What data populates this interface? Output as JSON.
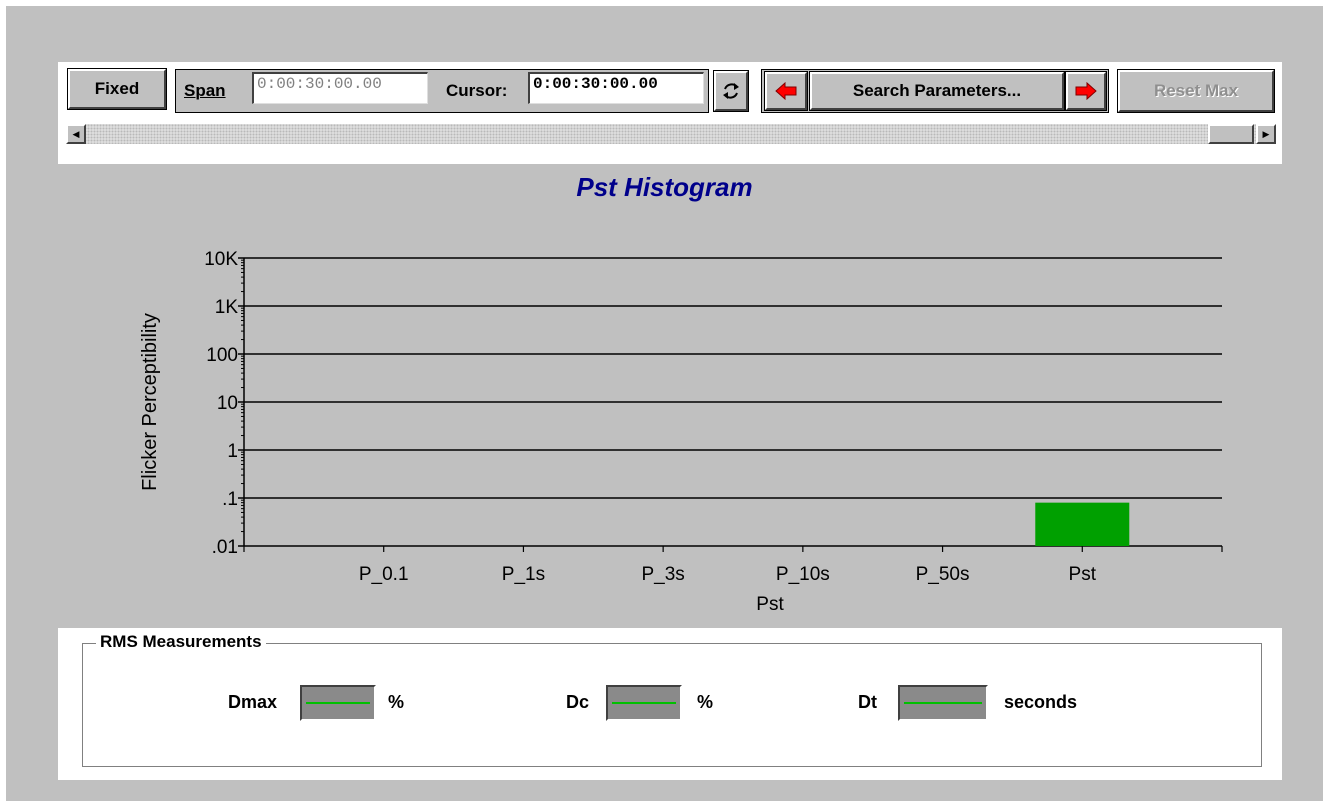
{
  "toolbar": {
    "fixed_label": "Fixed",
    "span_label": "Span",
    "span_value": "0:00:30:00.00",
    "cursor_label": "Cursor:",
    "cursor_value": "0:00:30:00.00",
    "refresh_icon": "refresh-icon",
    "prev_icon": "left-arrow-icon",
    "search_label": "Search Parameters...",
    "next_icon": "right-arrow-icon",
    "reset_label": "Reset Max",
    "reset_enabled": false
  },
  "scrollbar": {
    "left_icon": "scroll-left-icon",
    "right_icon": "scroll-right-icon",
    "thumb_position": "right"
  },
  "chart_data": {
    "type": "bar",
    "title": "Pst Histogram",
    "xlabel": "Pst",
    "ylabel": "Flicker Perceptibility",
    "y_scale": "log",
    "ylim": [
      0.01,
      10000
    ],
    "y_ticks": [
      ".01",
      ".1",
      "1",
      "10",
      "100",
      "1K",
      "10K"
    ],
    "grid": true,
    "categories": [
      "P_0.1",
      "P_1s",
      "P_3s",
      "P_10s",
      "P_50s",
      "Pst"
    ],
    "values": [
      null,
      null,
      null,
      null,
      null,
      0.08
    ],
    "bar_color": "#00a000"
  },
  "rms": {
    "title": "RMS Measurements",
    "dmax_label": "Dmax",
    "dmax_unit": "%",
    "dc_label": "Dc",
    "dc_unit": "%",
    "dt_label": "Dt",
    "dt_unit": "seconds"
  }
}
